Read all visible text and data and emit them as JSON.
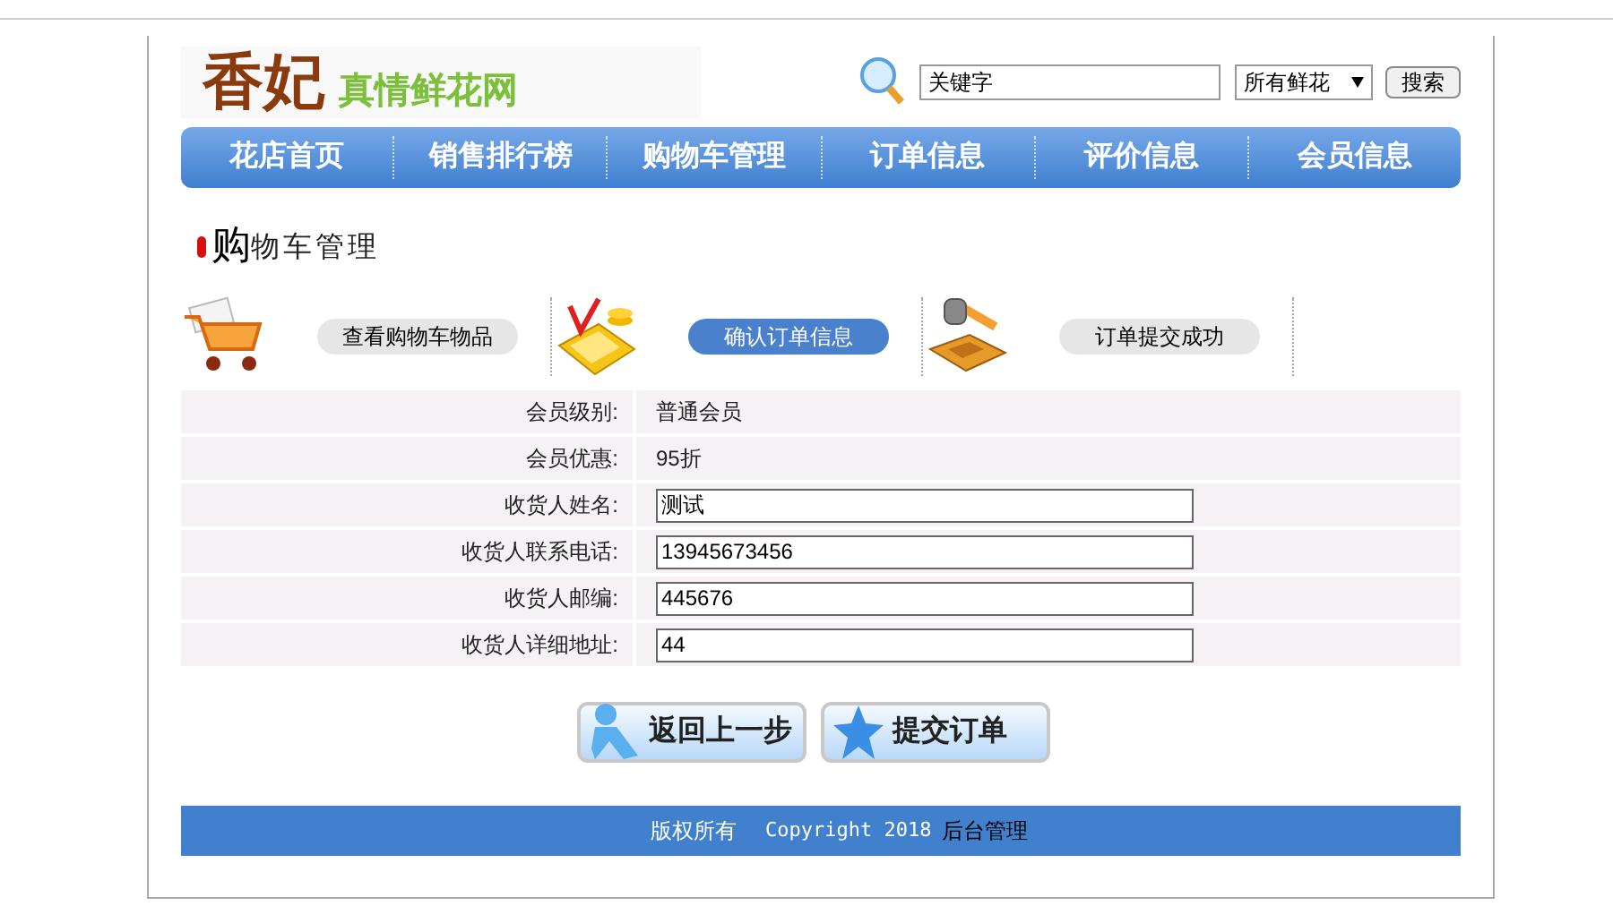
{
  "header": {
    "logo_name": "香妃",
    "logo_slogan": "真情鲜花网",
    "search": {
      "value": "关键字"
    },
    "category": {
      "value": "所有鲜花"
    },
    "search_button": "搜索"
  },
  "nav": [
    "花店首页",
    "销售排行榜",
    "购物车管理",
    "订单信息",
    "评价信息",
    "会员信息"
  ],
  "title": {
    "initial": "购",
    "rest": "物车管理"
  },
  "steps": [
    {
      "kind": "cart",
      "label": "查看购物车物品",
      "selected": false
    },
    {
      "kind": "calculator",
      "label": "确认订单信息",
      "selected": true
    },
    {
      "kind": "hammer",
      "label": "订单提交成功",
      "selected": false
    }
  ],
  "form": [
    {
      "kind": "text",
      "label": "会员级别:",
      "value": "普通会员"
    },
    {
      "kind": "text",
      "label": "会员优惠:",
      "value": "95折"
    },
    {
      "kind": "input",
      "label": "收货人姓名:",
      "value": "测试"
    },
    {
      "kind": "input",
      "label": "收货人联系电话:",
      "value": "13945673456"
    },
    {
      "kind": "input",
      "label": "收货人邮编:",
      "value": "445676"
    },
    {
      "kind": "input",
      "label": "收货人详细地址:",
      "value": "44"
    }
  ],
  "buttons": [
    {
      "kind": "back",
      "label": "返回上一步"
    },
    {
      "kind": "submit",
      "label": "提交订单"
    }
  ],
  "footer": {
    "rights": "版权所有",
    "copyright": "Copyright 2018",
    "admin_link": "后台管理"
  }
}
